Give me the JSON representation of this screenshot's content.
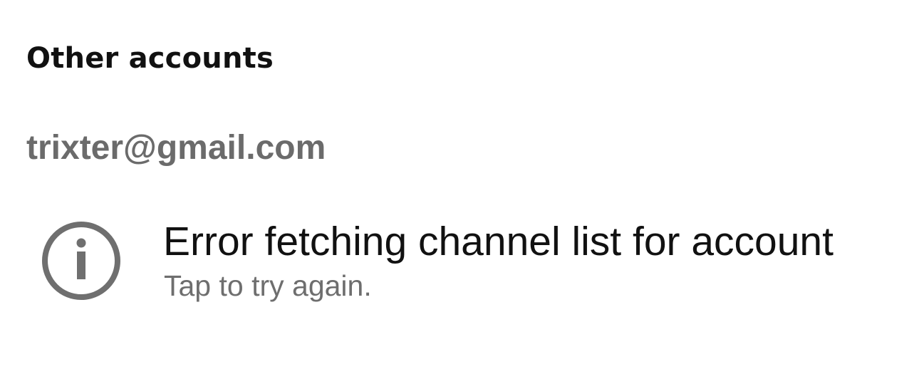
{
  "section": {
    "title": "Other accounts"
  },
  "account": {
    "email": "trixter@gmail.com"
  },
  "error": {
    "icon": "info-icon",
    "title": "Error fetching channel list for account",
    "subtitle": "Tap to try again."
  },
  "colors": {
    "title": "#111111",
    "email": "#6b6b6b",
    "subtitle": "#6e6e6e",
    "icon": "#6f6f6f",
    "background": "#ffffff"
  }
}
